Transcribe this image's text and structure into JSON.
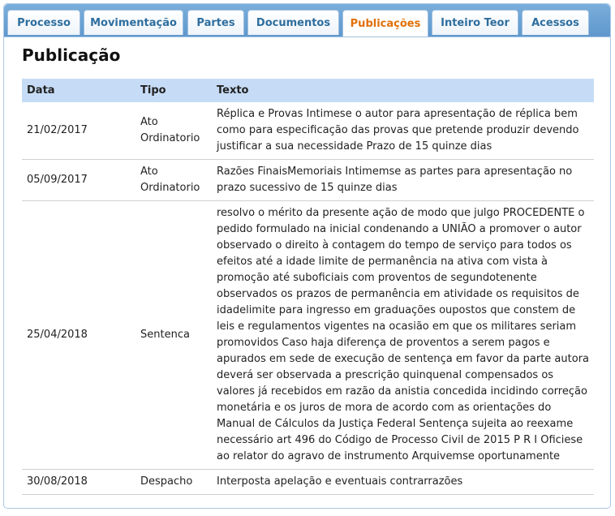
{
  "tabs": [
    {
      "label": "Processo",
      "active": false
    },
    {
      "label": "Movimentação",
      "active": false
    },
    {
      "label": "Partes",
      "active": false
    },
    {
      "label": "Documentos",
      "active": false
    },
    {
      "label": "Publicações",
      "active": true
    },
    {
      "label": "Inteiro Teor",
      "active": false
    },
    {
      "label": "Acessos",
      "active": false
    }
  ],
  "page_title": "Publicação",
  "table": {
    "headers": [
      "Data",
      "Tipo",
      "Texto"
    ],
    "rows": [
      {
        "data": "21/02/2017",
        "tipo": "Ato Ordinatorio",
        "texto": "Réplica e Provas Intimese o autor para apresentação de réplica bem como para especificação das provas que pretende produzir devendo justificar a sua necessidade Prazo de 15 quinze dias"
      },
      {
        "data": "05/09/2017",
        "tipo": "Ato Ordinatorio",
        "texto": "Razões FinaisMemoriais Intimemse as partes para apresentação no prazo sucessivo de 15 quinze dias"
      },
      {
        "data": "25/04/2018",
        "tipo": "Sentenca",
        "texto": "resolvo o mérito da presente ação de modo que julgo PROCEDENTE o pedido formulado na inicial condenando a UNIÃO a promover o autor observado o direito à contagem do tempo de serviço para todos os efeitos até a idade limite de permanência na ativa com vista à promoção até suboficiais com proventos de segundotenente observados os prazos de permanência em atividade os requisitos de idadelimite para ingresso em graduações oupostos que constem de leis e regulamentos vigentes na ocasião em que os militares seriam promovidos Caso haja diferença de proventos a serem pagos e apurados em sede de execução de sentença em favor da parte autora deverá ser observada a prescrição quinquenal compensados os valores já recebidos em razão da anistia concedida incidindo correção monetária e os juros de mora de acordo com as orientações do Manual de Cálculos da Justiça Federal Sentença sujeita ao reexame necessário art 496 do Código de Processo Civil de 2015 P R I Oficiese ao relator do agravo de instrumento Arquivemse oportunamente"
      },
      {
        "data": "30/08/2018",
        "tipo": "Despacho",
        "texto": "Interposta apelação e eventuais contrarrazões"
      }
    ]
  }
}
